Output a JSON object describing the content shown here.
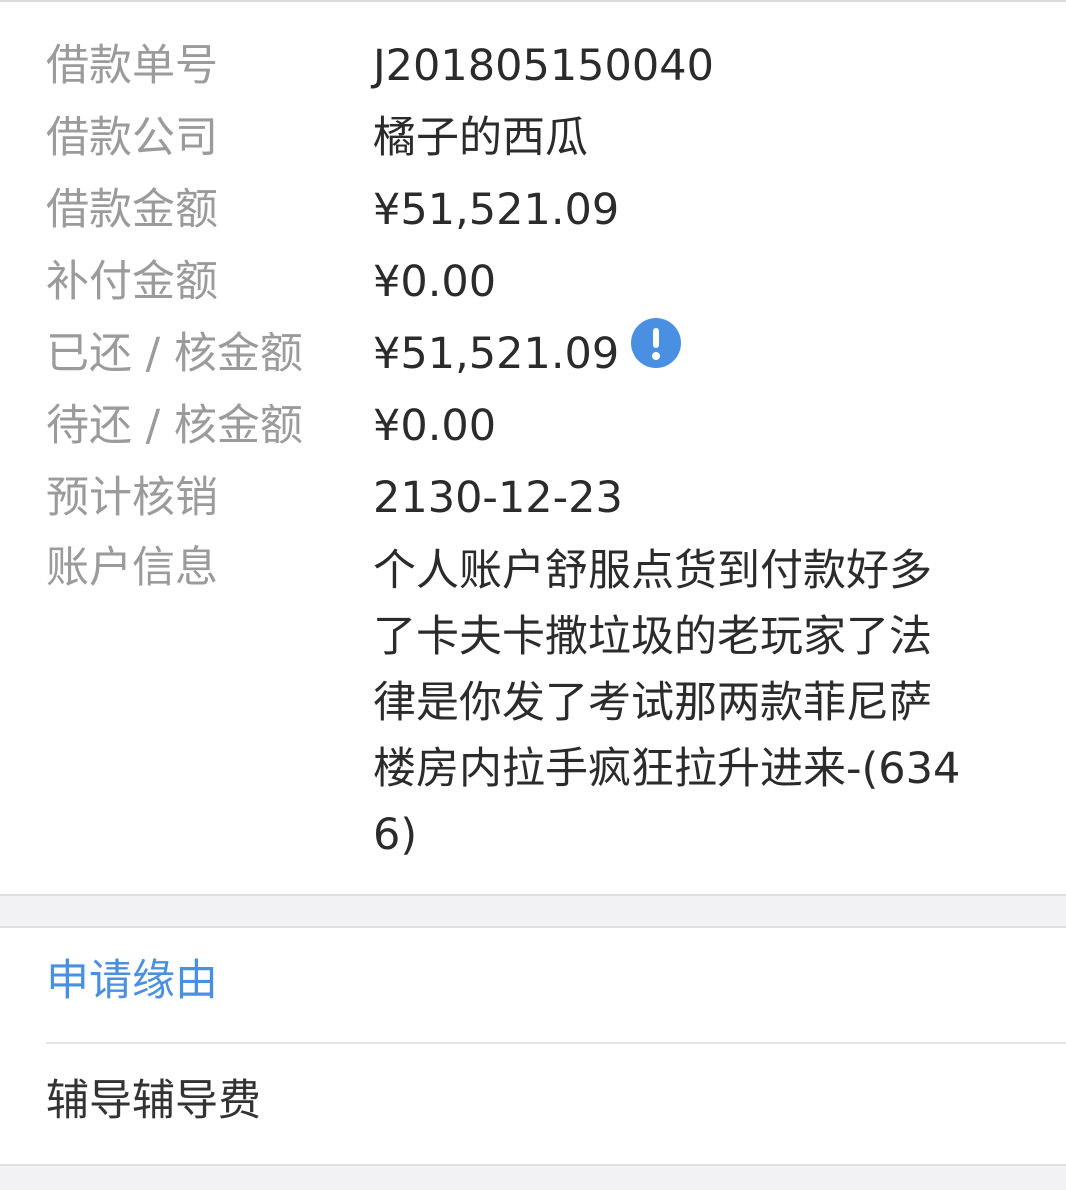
{
  "details": {
    "rows": [
      {
        "label": "借款单号",
        "value": "J201805150040"
      },
      {
        "label": "借款公司",
        "value": "橘子的西瓜"
      },
      {
        "label": "借款金额",
        "value": "¥51,521.09"
      },
      {
        "label": "补付金额",
        "value": "¥0.00"
      },
      {
        "label": "已还 / 核金额",
        "value": "¥51,521.09"
      },
      {
        "label": "待还 / 核金额",
        "value": "¥0.00"
      },
      {
        "label": "预计核销",
        "value": "2130-12-23"
      },
      {
        "label": "账户信息",
        "value": "个人账户舒服点货到付款好多了卡夫卡撒垃圾的老玩家了法律是你发了考试那两款菲尼萨楼房内拉手疯狂拉升进来-(6346)"
      }
    ],
    "alert_icon": "exclamation-circle-icon"
  },
  "reason": {
    "title": "申请缘由",
    "text": "辅导辅导费"
  },
  "colors": {
    "accent": "#4a90e2",
    "label": "#9b9b9b",
    "value": "#2b2b2b"
  }
}
